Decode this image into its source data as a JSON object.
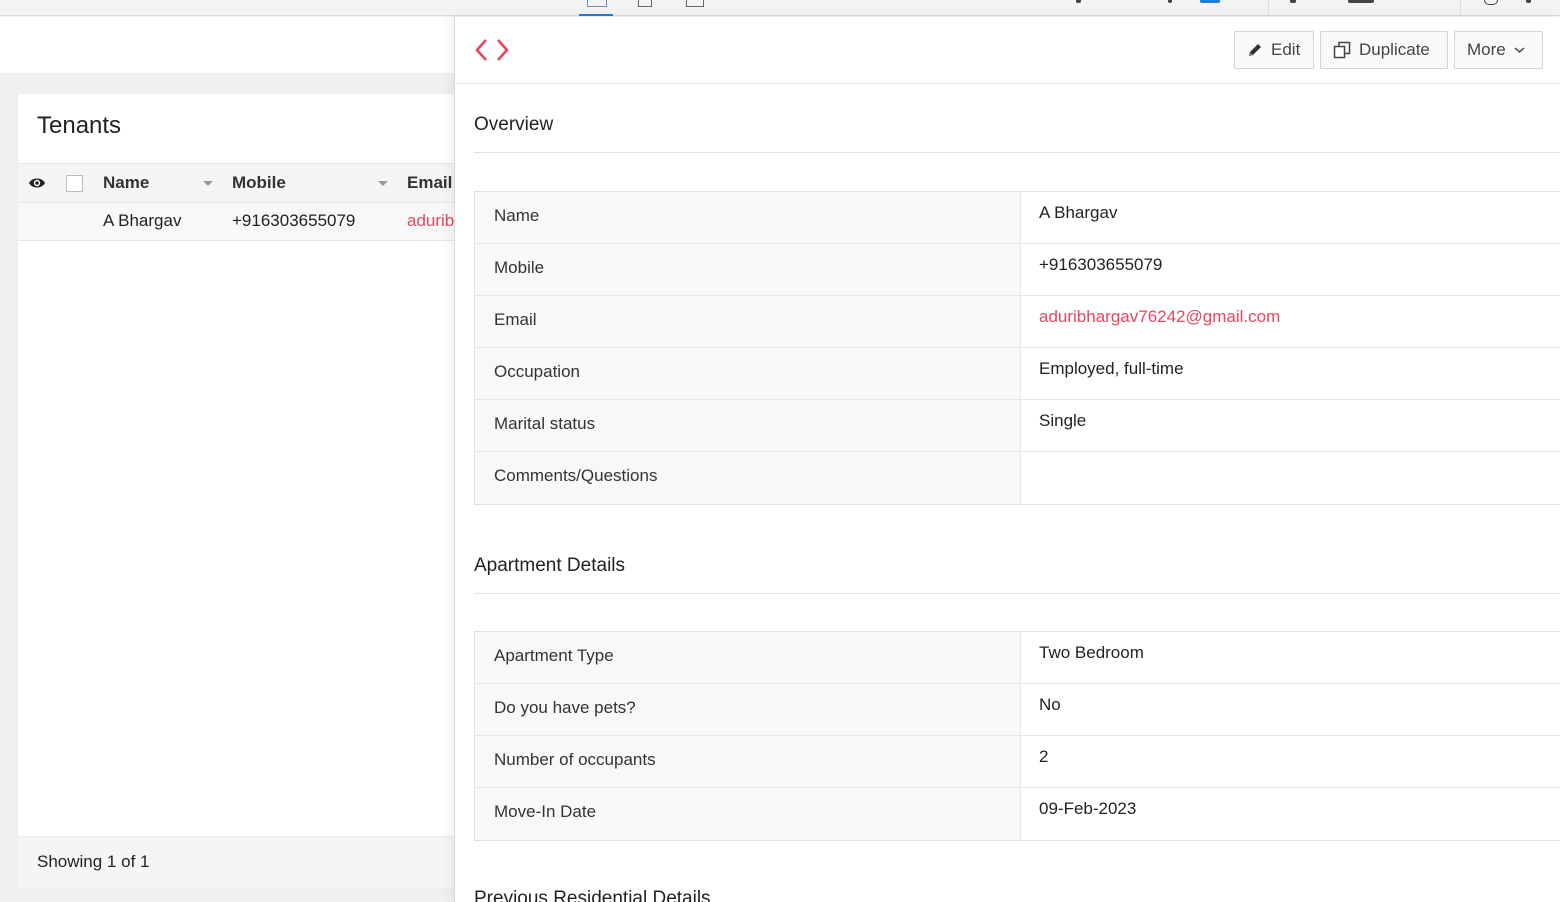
{
  "list_panel": {
    "title": "Tenants",
    "columns": [
      "Name",
      "Mobile",
      "Email"
    ],
    "rows": [
      {
        "name": "A Bhargav",
        "mobile": "+916303655079",
        "email": "adurib"
      }
    ],
    "footer": "Showing 1 of 1"
  },
  "toolbar": {
    "edit_label": "Edit",
    "duplicate_label": "Duplicate",
    "more_label": "More"
  },
  "sections": [
    {
      "title": "Overview",
      "fields": [
        {
          "label": "Name",
          "value": "A Bhargav"
        },
        {
          "label": "Mobile",
          "value": "+916303655079"
        },
        {
          "label": "Email",
          "value": "aduribhargav76242@gmail.com"
        },
        {
          "label": "Occupation",
          "value": "Employed, full-time"
        },
        {
          "label": "Marital status",
          "value": "Single"
        },
        {
          "label": "Comments/Questions",
          "value": ""
        }
      ]
    },
    {
      "title": "Apartment Details",
      "fields": [
        {
          "label": "Apartment Type",
          "value": "Two Bedroom"
        },
        {
          "label": "Do you have pets?",
          "value": "No"
        },
        {
          "label": "Number of occupants",
          "value": "2"
        },
        {
          "label": "Move-In Date",
          "value": "09-Feb-2023"
        }
      ]
    },
    {
      "title": "Previous Residential Details"
    }
  ],
  "colors": {
    "accent": "#e8455f",
    "active_tab": "#1f7ed6"
  },
  "icons": [
    "eye-icon",
    "code-icon",
    "pencil-icon",
    "duplicate-icon",
    "chevron-down-icon",
    "sort-caret-icon"
  ]
}
